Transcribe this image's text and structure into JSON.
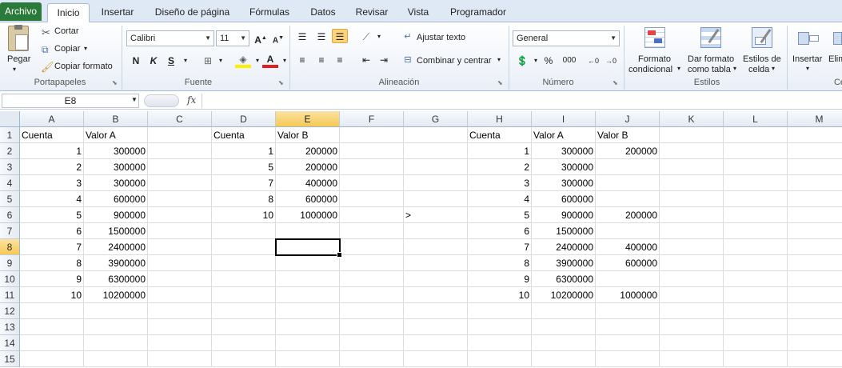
{
  "tabs": [
    "Archivo",
    "Inicio",
    "Insertar",
    "Diseño de página",
    "Fórmulas",
    "Datos",
    "Revisar",
    "Vista",
    "Programador"
  ],
  "ribbon": {
    "clipboard": {
      "paste": "Pegar",
      "cut": "Cortar",
      "copy": "Copiar",
      "format_painter": "Copiar formato",
      "label": "Portapapeles"
    },
    "font": {
      "name": "Calibri",
      "size": "11",
      "bold": "N",
      "italic": "K",
      "underline": "S",
      "label": "Fuente"
    },
    "alignment": {
      "wrap": "Ajustar texto",
      "merge": "Combinar y centrar",
      "label": "Alineación"
    },
    "number": {
      "format": "General",
      "percent": "%",
      "thousands": "000",
      "label": "Número"
    },
    "styles": {
      "conditional_l1": "Formato",
      "conditional_l2": "condicional",
      "table_l1": "Dar formato",
      "table_l2": "como tabla",
      "cell_l1": "Estilos de",
      "cell_l2": "celda",
      "label": "Estilos"
    },
    "cells": {
      "insert": "Insertar",
      "delete": "Elim",
      "label": "Ce"
    }
  },
  "formula_bar": {
    "name_box": "E8",
    "fx": "fx",
    "value": ""
  },
  "columns": [
    "A",
    "B",
    "C",
    "D",
    "E",
    "F",
    "G",
    "H",
    "I",
    "J",
    "K",
    "L",
    "M"
  ],
  "active_column": "E",
  "rows": [
    "1",
    "2",
    "3",
    "4",
    "5",
    "6",
    "7",
    "8",
    "9",
    "10",
    "11",
    "12",
    "13",
    "14",
    "15"
  ],
  "active_row": "8",
  "cells": [
    {
      "r": 1,
      "c": "A",
      "v": "Cuenta"
    },
    {
      "r": 1,
      "c": "B",
      "v": "Valor A"
    },
    {
      "r": 1,
      "c": "D",
      "v": "Cuenta"
    },
    {
      "r": 1,
      "c": "E",
      "v": "Valor B"
    },
    {
      "r": 1,
      "c": "H",
      "v": "Cuenta"
    },
    {
      "r": 1,
      "c": "I",
      "v": "Valor A"
    },
    {
      "r": 1,
      "c": "J",
      "v": "Valor B"
    },
    {
      "r": 2,
      "c": "A",
      "v": "1",
      "n": 1
    },
    {
      "r": 2,
      "c": "B",
      "v": "300000",
      "n": 1
    },
    {
      "r": 2,
      "c": "D",
      "v": "1",
      "n": 1
    },
    {
      "r": 2,
      "c": "E",
      "v": "200000",
      "n": 1
    },
    {
      "r": 2,
      "c": "H",
      "v": "1",
      "n": 1
    },
    {
      "r": 2,
      "c": "I",
      "v": "300000",
      "n": 1
    },
    {
      "r": 2,
      "c": "J",
      "v": "200000",
      "n": 1
    },
    {
      "r": 3,
      "c": "A",
      "v": "2",
      "n": 1
    },
    {
      "r": 3,
      "c": "B",
      "v": "300000",
      "n": 1
    },
    {
      "r": 3,
      "c": "D",
      "v": "5",
      "n": 1
    },
    {
      "r": 3,
      "c": "E",
      "v": "200000",
      "n": 1
    },
    {
      "r": 3,
      "c": "H",
      "v": "2",
      "n": 1
    },
    {
      "r": 3,
      "c": "I",
      "v": "300000",
      "n": 1
    },
    {
      "r": 4,
      "c": "A",
      "v": "3",
      "n": 1
    },
    {
      "r": 4,
      "c": "B",
      "v": "300000",
      "n": 1
    },
    {
      "r": 4,
      "c": "D",
      "v": "7",
      "n": 1
    },
    {
      "r": 4,
      "c": "E",
      "v": "400000",
      "n": 1
    },
    {
      "r": 4,
      "c": "H",
      "v": "3",
      "n": 1
    },
    {
      "r": 4,
      "c": "I",
      "v": "300000",
      "n": 1
    },
    {
      "r": 5,
      "c": "A",
      "v": "4",
      "n": 1
    },
    {
      "r": 5,
      "c": "B",
      "v": "600000",
      "n": 1
    },
    {
      "r": 5,
      "c": "D",
      "v": "8",
      "n": 1
    },
    {
      "r": 5,
      "c": "E",
      "v": "600000",
      "n": 1
    },
    {
      "r": 5,
      "c": "H",
      "v": "4",
      "n": 1
    },
    {
      "r": 5,
      "c": "I",
      "v": "600000",
      "n": 1
    },
    {
      "r": 6,
      "c": "A",
      "v": "5",
      "n": 1
    },
    {
      "r": 6,
      "c": "B",
      "v": "900000",
      "n": 1
    },
    {
      "r": 6,
      "c": "D",
      "v": "10",
      "n": 1
    },
    {
      "r": 6,
      "c": "E",
      "v": "1000000",
      "n": 1
    },
    {
      "r": 6,
      "c": "G",
      "v": ">"
    },
    {
      "r": 6,
      "c": "H",
      "v": "5",
      "n": 1
    },
    {
      "r": 6,
      "c": "I",
      "v": "900000",
      "n": 1
    },
    {
      "r": 6,
      "c": "J",
      "v": "200000",
      "n": 1
    },
    {
      "r": 7,
      "c": "A",
      "v": "6",
      "n": 1
    },
    {
      "r": 7,
      "c": "B",
      "v": "1500000",
      "n": 1
    },
    {
      "r": 7,
      "c": "H",
      "v": "6",
      "n": 1
    },
    {
      "r": 7,
      "c": "I",
      "v": "1500000",
      "n": 1
    },
    {
      "r": 8,
      "c": "A",
      "v": "7",
      "n": 1
    },
    {
      "r": 8,
      "c": "B",
      "v": "2400000",
      "n": 1
    },
    {
      "r": 8,
      "c": "H",
      "v": "7",
      "n": 1
    },
    {
      "r": 8,
      "c": "I",
      "v": "2400000",
      "n": 1
    },
    {
      "r": 8,
      "c": "J",
      "v": "400000",
      "n": 1
    },
    {
      "r": 9,
      "c": "A",
      "v": "8",
      "n": 1
    },
    {
      "r": 9,
      "c": "B",
      "v": "3900000",
      "n": 1
    },
    {
      "r": 9,
      "c": "H",
      "v": "8",
      "n": 1
    },
    {
      "r": 9,
      "c": "I",
      "v": "3900000",
      "n": 1
    },
    {
      "r": 9,
      "c": "J",
      "v": "600000",
      "n": 1
    },
    {
      "r": 10,
      "c": "A",
      "v": "9",
      "n": 1
    },
    {
      "r": 10,
      "c": "B",
      "v": "6300000",
      "n": 1
    },
    {
      "r": 10,
      "c": "H",
      "v": "9",
      "n": 1
    },
    {
      "r": 10,
      "c": "I",
      "v": "6300000",
      "n": 1
    },
    {
      "r": 11,
      "c": "A",
      "v": "10",
      "n": 1
    },
    {
      "r": 11,
      "c": "B",
      "v": "10200000",
      "n": 1
    },
    {
      "r": 11,
      "c": "H",
      "v": "10",
      "n": 1
    },
    {
      "r": 11,
      "c": "I",
      "v": "10200000",
      "n": 1
    },
    {
      "r": 11,
      "c": "J",
      "v": "1000000",
      "n": 1
    }
  ],
  "colors": {
    "file_tab": "#2a7a39",
    "active_header": "#f6c955",
    "grid_line": "#dadcdd"
  }
}
